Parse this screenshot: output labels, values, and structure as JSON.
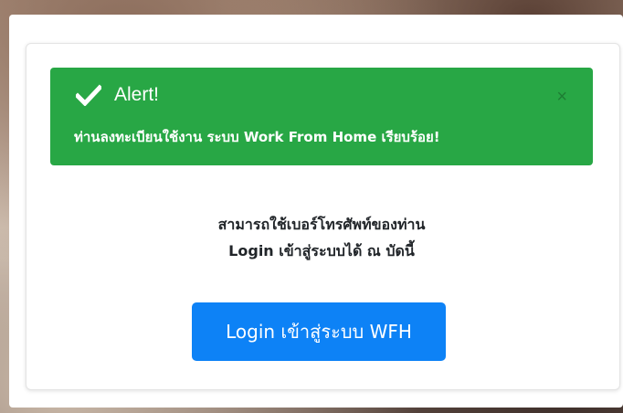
{
  "alert": {
    "title": "Alert!",
    "message": "ท่านลงทะเบียนใช้งาน ระบบ Work From Home เรียบร้อย!",
    "close_symbol": "×",
    "icon": "check-icon",
    "color": "#28a745"
  },
  "info": {
    "line1": "สามารถใช้เบอร์โทรศัพท์ของท่าน",
    "line2": "Login เข้าสู่ระบบได้ ณ บัดนี้"
  },
  "login_button": {
    "label": "Login เข้าสู่ระบบ WFH",
    "color": "#0d82f6"
  }
}
